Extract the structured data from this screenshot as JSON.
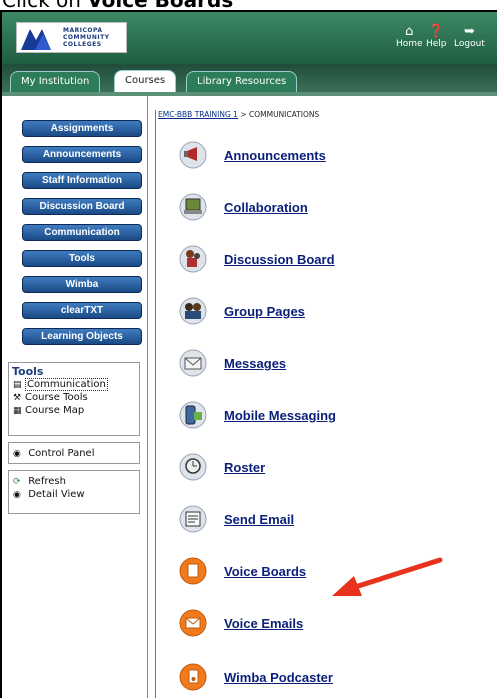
{
  "caption": {
    "prefix": "Click on ",
    "target": "Voice Boards"
  },
  "header": {
    "logo_lines": [
      "MARICOPA",
      "COMMUNITY",
      "COLLEGES"
    ],
    "nav": [
      {
        "icon": "home-icon",
        "label": "Home"
      },
      {
        "icon": "help-icon",
        "label": "Help"
      },
      {
        "icon": "logout-icon",
        "label": "Logout"
      }
    ]
  },
  "tabs": [
    {
      "label": "My Institution",
      "active": false
    },
    {
      "label": "Courses",
      "active": true
    },
    {
      "label": "Library Resources",
      "active": false
    }
  ],
  "sidebar": {
    "buttons": [
      "Assignments",
      "Announcements",
      "Staff Information",
      "Discussion Board",
      "Communication",
      "Tools",
      "Wimba",
      "clearTXT",
      "Learning Objects"
    ],
    "tools": {
      "title": "Tools",
      "items": [
        {
          "icon": "communication-icon",
          "label": "Communication"
        },
        {
          "icon": "course-tools-icon",
          "label": "Course Tools"
        },
        {
          "icon": "course-map-icon",
          "label": "Course Map"
        }
      ]
    },
    "control_panel": {
      "icon": "control-panel-icon",
      "label": "Control Panel"
    },
    "views": [
      {
        "icon": "refresh-icon",
        "label": "Refresh"
      },
      {
        "icon": "detail-view-icon",
        "label": "Detail View"
      }
    ]
  },
  "breadcrumb": {
    "course": "EMC-BBB TRAINING 1",
    "separator": " > ",
    "current": "COMMUNICATIONS"
  },
  "items": [
    {
      "label": "Announcements",
      "icon": "announcements-icon"
    },
    {
      "label": "Collaboration",
      "icon": "collaboration-icon"
    },
    {
      "label": "Discussion Board",
      "icon": "discussion-board-icon"
    },
    {
      "label": "Group Pages",
      "icon": "group-pages-icon"
    },
    {
      "label": "Messages",
      "icon": "messages-icon"
    },
    {
      "label": "Mobile Messaging",
      "icon": "mobile-messaging-icon"
    },
    {
      "label": "Roster",
      "icon": "roster-icon"
    },
    {
      "label": "Send Email",
      "icon": "send-email-icon"
    },
    {
      "label": "Voice Boards",
      "icon": "voice-boards-icon"
    },
    {
      "label": "Voice Emails",
      "icon": "voice-emails-icon"
    },
    {
      "label": "Wimba Podcaster",
      "icon": "wimba-podcaster-icon"
    }
  ],
  "colors": {
    "header": "#2a6e4f",
    "nav_button": "#1f4f8a",
    "link": "#0a1f7a",
    "arrow": "#e8321e",
    "wimba_icon": "#f07a1c"
  }
}
